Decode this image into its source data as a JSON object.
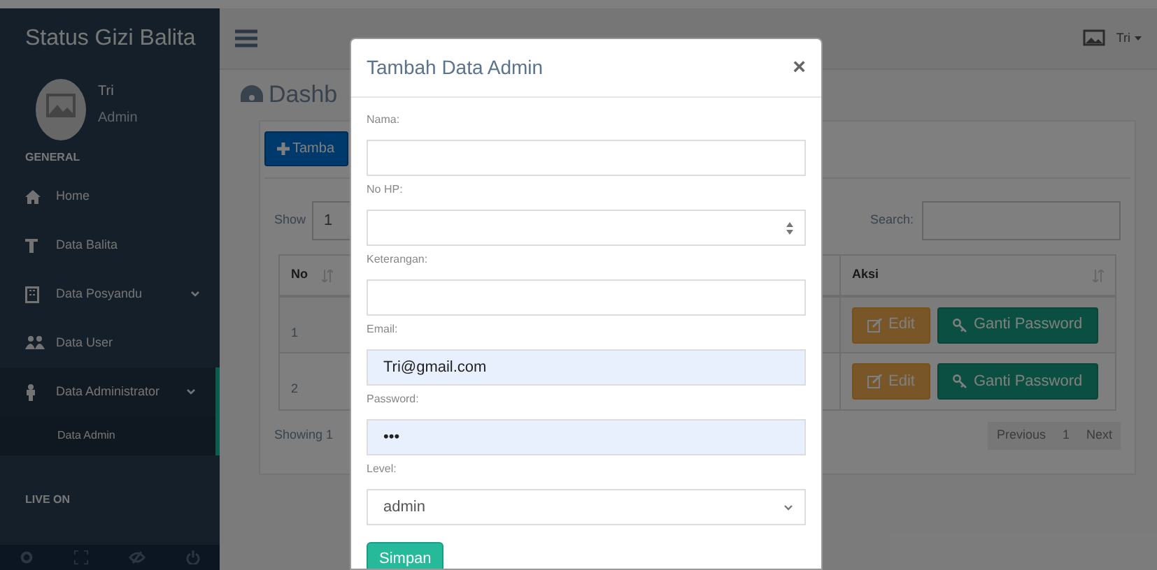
{
  "sidebar": {
    "title": "Status Gizi Balita",
    "user": {
      "name": "Tri",
      "role": "Admin"
    },
    "general_heading": "GENERAL",
    "items": [
      {
        "label": "Home",
        "expandable": false,
        "selected": false
      },
      {
        "label": "Data Balita",
        "expandable": false,
        "selected": false
      },
      {
        "label": "Data Posyandu",
        "expandable": true,
        "selected": false
      },
      {
        "label": "Data User",
        "expandable": false,
        "selected": false
      },
      {
        "label": "Data Administrator",
        "expandable": true,
        "selected": true,
        "children": [
          {
            "label": "Data Admin",
            "selected": true
          }
        ]
      }
    ],
    "live_heading": "LIVE ON"
  },
  "topbar": {
    "user": "Tri"
  },
  "page": {
    "title": "Dashb",
    "add_button": "Tamba",
    "length_label": "Show",
    "length_value": "1",
    "search_label": "Search:",
    "table": {
      "columns": [
        "No",
        "Aksi"
      ],
      "rows": [
        {
          "no": "1",
          "actions": [
            "Edit",
            "Ganti Password"
          ]
        },
        {
          "no": "2",
          "actions": [
            "Edit",
            "Ganti Password"
          ]
        }
      ]
    },
    "info": "Showing 1",
    "pagination": [
      "Previous",
      "1",
      "Next"
    ]
  },
  "modal": {
    "title": "Tambah Data Admin",
    "close": "×",
    "fields": [
      {
        "label": "Nama:",
        "kind": "text",
        "autofilled": false
      },
      {
        "label": "No HP:",
        "kind": "number",
        "autofilled": false
      },
      {
        "label": "Keterangan:",
        "kind": "text",
        "autofilled": false
      },
      {
        "label": "Email:",
        "kind": "text",
        "value": "Tri@gmail.com",
        "autofilled": true
      },
      {
        "label": "Password:",
        "kind": "text",
        "value": "•••",
        "autofilled": true
      },
      {
        "label": "Level:",
        "kind": "select",
        "value": "admin",
        "autofilled": false
      }
    ],
    "submit": "Simpan"
  }
}
